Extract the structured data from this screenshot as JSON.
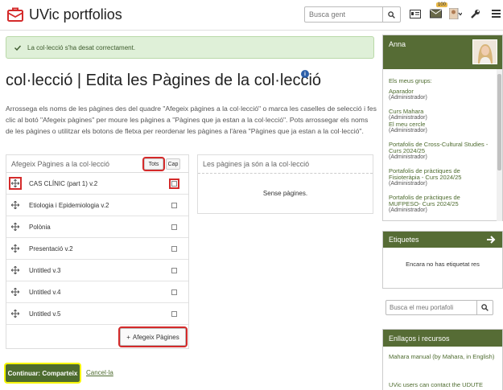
{
  "header": {
    "site_title": "UVic portfolios",
    "search_placeholder": "Busca gent",
    "badge_count": "100"
  },
  "alert": {
    "message": "La col·lecció s'ha desat correctament."
  },
  "page_title": "col·lecció | Edita les Pàgines de la col·lecció",
  "description": "Arrossega els noms de les pàgines des del quadre \"Afegeix pàgines a la col·lecció\" o marca les caselles de selecció i fes clic al botó \"Afegeix pàgines\" per moure les pàgines a \"Pàgines que ja estan a la col·lecció\". Pots arrossegar els noms de les pàgines o utilitzar els botons de fletxa per reordenar les pàgines a l'àrea \"Pàgines que ja estan a la col·lecció\".",
  "add_panel": {
    "title": "Afegeix Pàgines a la col·lecció",
    "all_label": "Tots",
    "none_label": "Cap",
    "pages": [
      "CAS CLÍNIC (part 1) v.2",
      "Etiologia i Epidemiologia v.2",
      "Polònia",
      "Presentació v.2",
      "Untitled v.3",
      "Untitled v.4",
      "Untitled v.5"
    ],
    "add_button": "Afegeix Pàgines"
  },
  "existing_panel": {
    "title": "Les pàgines ja són a la col·lecció",
    "empty_text": "Sense pàgines."
  },
  "actions": {
    "continue_label": "Continuar: Comparteix",
    "cancel_label": "Cancel·la"
  },
  "sidebar": {
    "user": {
      "name": "Anna",
      "groups_title": "Els meus grups:",
      "groups": [
        {
          "name": "Aparador",
          "role": "(Administrador)"
        },
        {
          "name": "Curs Mahara",
          "role": "(Administrador)"
        },
        {
          "name": "El meu cercle",
          "role": "(Administrador)"
        },
        {
          "name": "Portafolis de Cross-Cultural Studies - Curs 2024/25",
          "role": "(Administrador)"
        },
        {
          "name": "Portafolis de pràctiques de Fisioteràpia - Curs 2024/25",
          "role": "(Administrador)"
        },
        {
          "name": "Portafolis de pràctiques de MUFPESO- Curs 2024/25",
          "role": "(Administrador)"
        }
      ]
    },
    "tags": {
      "title": "Etiquetes",
      "empty_text": "Encara no has etiquetat res"
    },
    "search": {
      "placeholder": "Busca el meu portafoli"
    },
    "links": {
      "title": "Enllaços i recursos",
      "items": [
        "Mahara manual (by Mahara, in English)",
        "UVic users can contact the UDUTE"
      ]
    }
  }
}
